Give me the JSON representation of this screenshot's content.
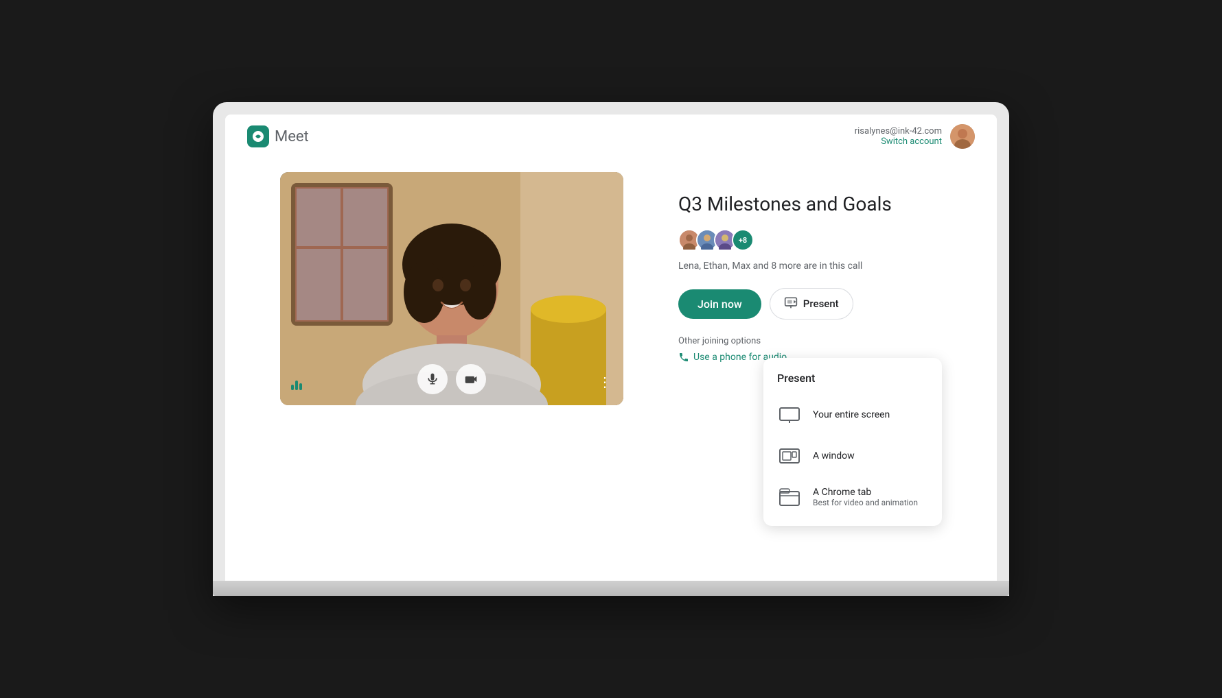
{
  "app": {
    "name": "Meet",
    "logo_color": "#1a8a72"
  },
  "header": {
    "user_email": "risalynes@ink-42.com",
    "switch_account_label": "Switch account"
  },
  "meeting": {
    "title": "Q3 Milestones and Goals",
    "participants_text": "Lena, Ethan, Max and 8 more are in this call",
    "participant_count": "+8"
  },
  "buttons": {
    "join_now": "Join now",
    "present": "Present",
    "other_options": "Other joining options",
    "phone_audio": "Use a phone for audio"
  },
  "present_dropdown": {
    "title": "Present",
    "items": [
      {
        "label": "Your entire screen",
        "sub": ""
      },
      {
        "label": "A window",
        "sub": ""
      },
      {
        "label": "A Chrome tab",
        "sub": "Best for video and animation"
      }
    ]
  },
  "video": {
    "more_options": "⋮"
  }
}
